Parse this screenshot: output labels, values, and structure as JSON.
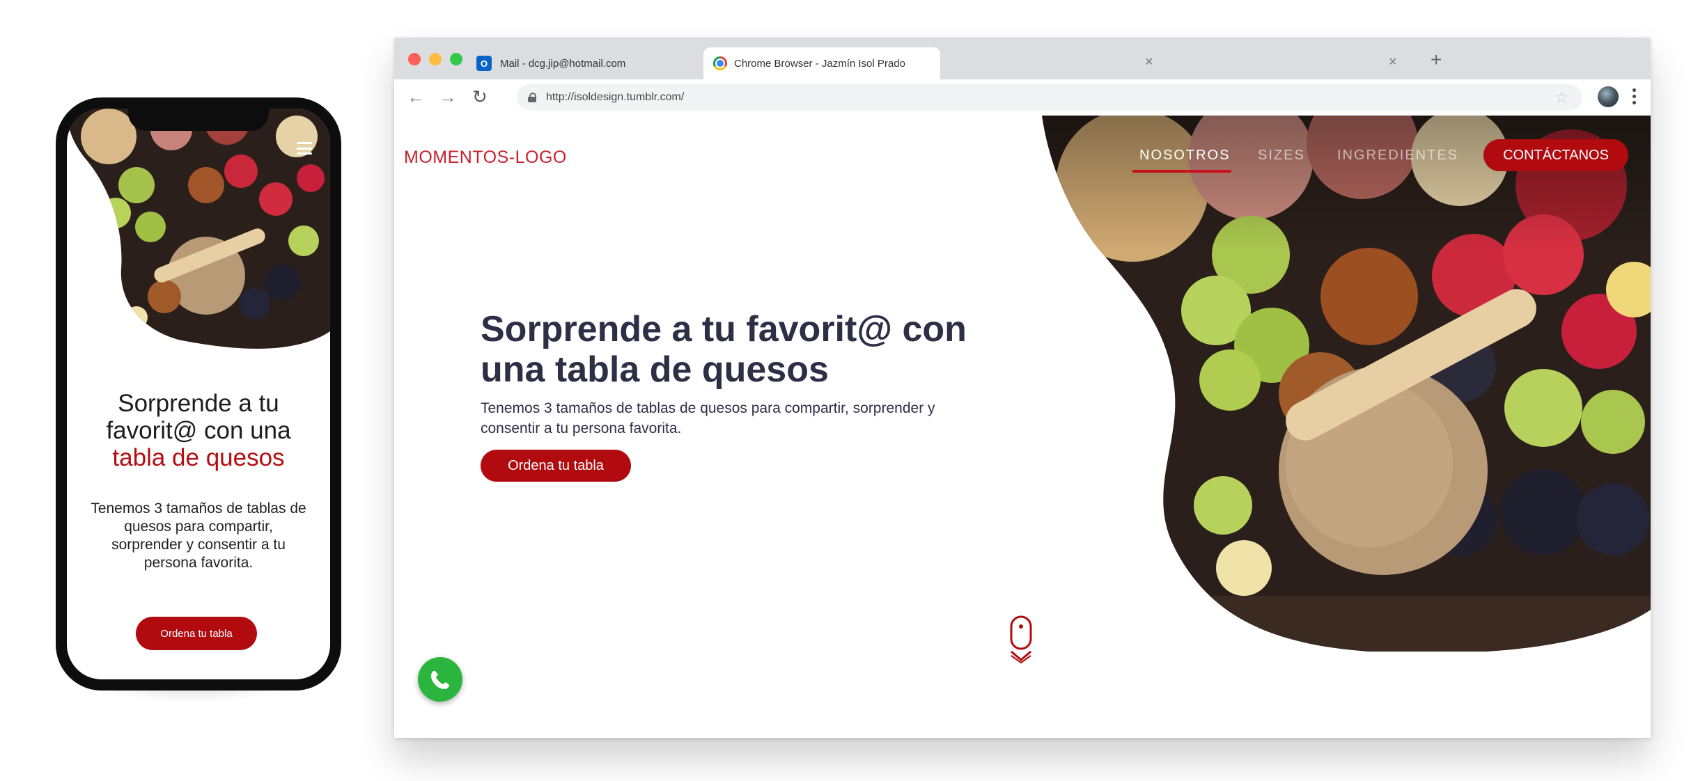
{
  "phone": {
    "title_line1": "Sorprende a tu",
    "title_line2": "favorit@ con una",
    "title_accent": "tabla de quesos",
    "text": "Tenemos 3 tamaños de tablas de quesos para compartir, sorprender y consentir a tu persona favorita.",
    "cta": "Ordena tu tabla",
    "menu_icon": "hamburger-icon"
  },
  "browser": {
    "tabs": [
      {
        "label": "Mail - dcg.jip@hotmail.com",
        "icon": "outlook-icon"
      },
      {
        "label": "Chrome Browser - Jazmín Isol Prado",
        "icon": "chrome-icon"
      }
    ],
    "url": "http://isoldesign.tumblr.com/"
  },
  "site": {
    "logo": "MOMENTOS-LOGO",
    "nav": [
      "NOSOTROS",
      "SIZES",
      "INGREDIENTES"
    ],
    "active_nav": "NOSOTROS",
    "cta": "CONTÁCTANOS",
    "hero_title": "Sorprende a tu favorit@ con una tabla de quesos",
    "hero_text": "Tenemos 3 tamaños de tablas de quesos para compartir, sorprender y consentir a tu persona favorita.",
    "hero_cta": "Ordena tu tabla",
    "scroll_icon": "mouse-scroll-icon",
    "chat_icon": "whatsapp-icon"
  },
  "colors": {
    "accent": "#b10a0f",
    "heading": "#2c2f45",
    "logo": "#c8202b"
  }
}
